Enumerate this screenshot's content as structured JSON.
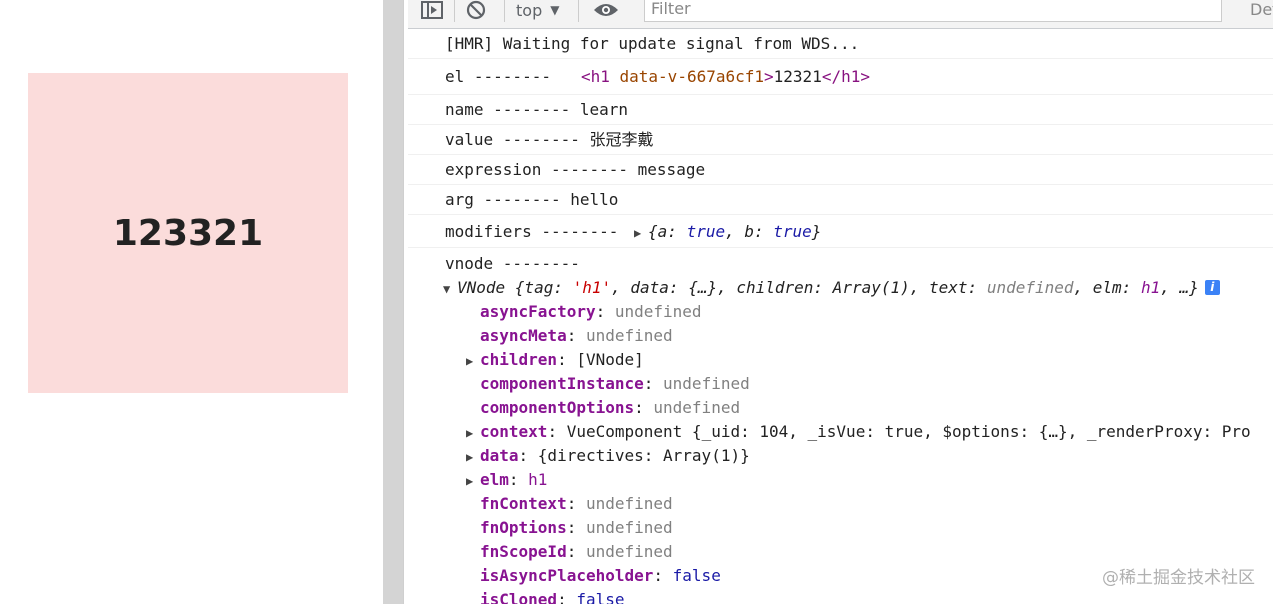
{
  "page": {
    "heading": "123321"
  },
  "toolbar": {
    "context": "top",
    "filter_placeholder": "Filter",
    "levels": "Defa"
  },
  "console": {
    "hmr": "[HMR] Waiting for update signal from WDS...",
    "el_label": "el --------",
    "el_tag_open": "<h1",
    "el_attr": "data-v-667a6cf1",
    "el_content": "12321",
    "el_tag_close": "</h1>",
    "name": "name -------- learn",
    "value": "value -------- 张冠李戴",
    "expression": "expression -------- message",
    "arg": "arg -------- hello",
    "modifiers_label": "modifiers --------",
    "modifiers_open": "{a: ",
    "modifiers_a": "true",
    "modifiers_mid": ", b: ",
    "modifiers_b": "true",
    "modifiers_close": "}",
    "vnode_label": "vnode --------",
    "vnode_summary": {
      "prefix": "VNode {tag: ",
      "tag": "'h1'",
      "rest1": ", data: {…}, children: Array(1), text: ",
      "text": "undefined",
      "rest2": ", elm: ",
      "elm": "h1",
      "rest3": ", …}"
    },
    "props": [
      {
        "key": "asyncFactory",
        "value": "undefined",
        "kind": "muted",
        "expandable": false
      },
      {
        "key": "asyncMeta",
        "value": "undefined",
        "kind": "muted",
        "expandable": false
      },
      {
        "key": "children",
        "value": "[VNode]",
        "kind": "plain",
        "expandable": true
      },
      {
        "key": "componentInstance",
        "value": "undefined",
        "kind": "muted",
        "expandable": false
      },
      {
        "key": "componentOptions",
        "value": "undefined",
        "kind": "muted",
        "expandable": false
      },
      {
        "key": "context",
        "value": "VueComponent {_uid: 104, _isVue: true, $options: {…}, _renderProxy: Pro",
        "kind": "plain",
        "expandable": true
      },
      {
        "key": "data",
        "value": "{directives: Array(1)}",
        "kind": "plain",
        "expandable": true
      },
      {
        "key": "elm",
        "value": "h1",
        "kind": "tag",
        "expandable": true
      },
      {
        "key": "fnContext",
        "value": "undefined",
        "kind": "muted",
        "expandable": false
      },
      {
        "key": "fnOptions",
        "value": "undefined",
        "kind": "muted",
        "expandable": false
      },
      {
        "key": "fnScopeId",
        "value": "undefined",
        "kind": "muted",
        "expandable": false
      },
      {
        "key": "isAsyncPlaceholder",
        "value": "false",
        "kind": "bool",
        "expandable": false
      },
      {
        "key": "isCloned",
        "value": "false",
        "kind": "bool",
        "expandable": false
      }
    ]
  },
  "watermark": "@稀土掘金技术社区"
}
